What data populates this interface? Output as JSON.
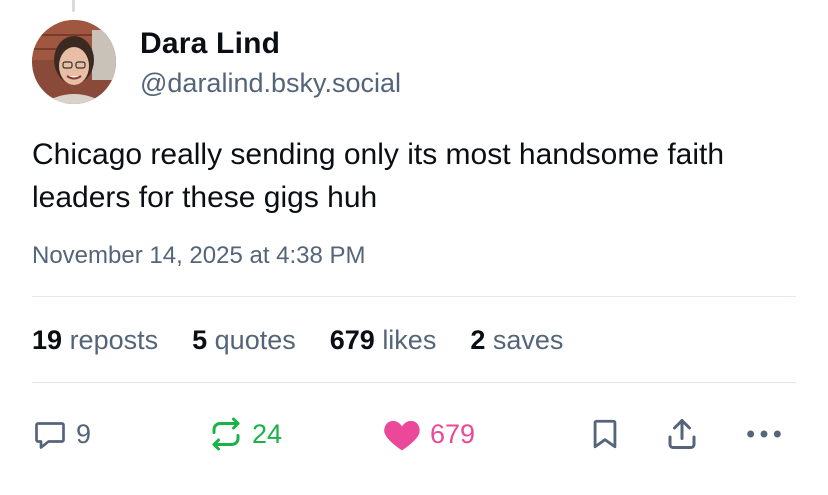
{
  "author": {
    "display_name": "Dara Lind",
    "handle": "@daralind.bsky.social"
  },
  "post": {
    "text": "Chicago really sending only its most handsome faith leaders for these gigs huh",
    "timestamp": "November 14, 2025 at 4:38 PM"
  },
  "stats": [
    {
      "count": "19",
      "label": "reposts"
    },
    {
      "count": "5",
      "label": "quotes"
    },
    {
      "count": "679",
      "label": "likes"
    },
    {
      "count": "2",
      "label": "saves"
    }
  ],
  "actions": {
    "reply_count": "9",
    "repost_count": "24",
    "like_count": "679"
  },
  "colors": {
    "muted": "#54657a",
    "repost_green": "#1ab34a",
    "like_pink": "#ec4899"
  },
  "icons": [
    "reply-icon",
    "repost-icon",
    "heart-icon",
    "bookmark-icon",
    "share-icon",
    "more-icon"
  ]
}
